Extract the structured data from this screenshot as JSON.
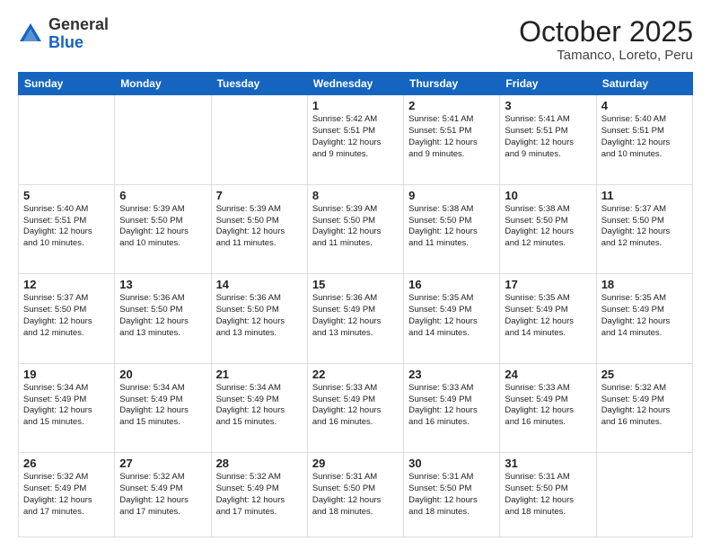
{
  "header": {
    "logo_general": "General",
    "logo_blue": "Blue",
    "month": "October 2025",
    "location": "Tamanco, Loreto, Peru"
  },
  "days_of_week": [
    "Sunday",
    "Monday",
    "Tuesday",
    "Wednesday",
    "Thursday",
    "Friday",
    "Saturday"
  ],
  "weeks": [
    [
      {
        "day": "",
        "content": "",
        "empty": true
      },
      {
        "day": "",
        "content": "",
        "empty": true
      },
      {
        "day": "",
        "content": "",
        "empty": true
      },
      {
        "day": "1",
        "content": "Sunrise: 5:42 AM\nSunset: 5:51 PM\nDaylight: 12 hours\nand 9 minutes."
      },
      {
        "day": "2",
        "content": "Sunrise: 5:41 AM\nSunset: 5:51 PM\nDaylight: 12 hours\nand 9 minutes."
      },
      {
        "day": "3",
        "content": "Sunrise: 5:41 AM\nSunset: 5:51 PM\nDaylight: 12 hours\nand 9 minutes."
      },
      {
        "day": "4",
        "content": "Sunrise: 5:40 AM\nSunset: 5:51 PM\nDaylight: 12 hours\nand 10 minutes."
      }
    ],
    [
      {
        "day": "5",
        "content": "Sunrise: 5:40 AM\nSunset: 5:51 PM\nDaylight: 12 hours\nand 10 minutes."
      },
      {
        "day": "6",
        "content": "Sunrise: 5:39 AM\nSunset: 5:50 PM\nDaylight: 12 hours\nand 10 minutes."
      },
      {
        "day": "7",
        "content": "Sunrise: 5:39 AM\nSunset: 5:50 PM\nDaylight: 12 hours\nand 11 minutes."
      },
      {
        "day": "8",
        "content": "Sunrise: 5:39 AM\nSunset: 5:50 PM\nDaylight: 12 hours\nand 11 minutes."
      },
      {
        "day": "9",
        "content": "Sunrise: 5:38 AM\nSunset: 5:50 PM\nDaylight: 12 hours\nand 11 minutes."
      },
      {
        "day": "10",
        "content": "Sunrise: 5:38 AM\nSunset: 5:50 PM\nDaylight: 12 hours\nand 12 minutes."
      },
      {
        "day": "11",
        "content": "Sunrise: 5:37 AM\nSunset: 5:50 PM\nDaylight: 12 hours\nand 12 minutes."
      }
    ],
    [
      {
        "day": "12",
        "content": "Sunrise: 5:37 AM\nSunset: 5:50 PM\nDaylight: 12 hours\nand 12 minutes."
      },
      {
        "day": "13",
        "content": "Sunrise: 5:36 AM\nSunset: 5:50 PM\nDaylight: 12 hours\nand 13 minutes."
      },
      {
        "day": "14",
        "content": "Sunrise: 5:36 AM\nSunset: 5:50 PM\nDaylight: 12 hours\nand 13 minutes."
      },
      {
        "day": "15",
        "content": "Sunrise: 5:36 AM\nSunset: 5:49 PM\nDaylight: 12 hours\nand 13 minutes."
      },
      {
        "day": "16",
        "content": "Sunrise: 5:35 AM\nSunset: 5:49 PM\nDaylight: 12 hours\nand 14 minutes."
      },
      {
        "day": "17",
        "content": "Sunrise: 5:35 AM\nSunset: 5:49 PM\nDaylight: 12 hours\nand 14 minutes."
      },
      {
        "day": "18",
        "content": "Sunrise: 5:35 AM\nSunset: 5:49 PM\nDaylight: 12 hours\nand 14 minutes."
      }
    ],
    [
      {
        "day": "19",
        "content": "Sunrise: 5:34 AM\nSunset: 5:49 PM\nDaylight: 12 hours\nand 15 minutes."
      },
      {
        "day": "20",
        "content": "Sunrise: 5:34 AM\nSunset: 5:49 PM\nDaylight: 12 hours\nand 15 minutes."
      },
      {
        "day": "21",
        "content": "Sunrise: 5:34 AM\nSunset: 5:49 PM\nDaylight: 12 hours\nand 15 minutes."
      },
      {
        "day": "22",
        "content": "Sunrise: 5:33 AM\nSunset: 5:49 PM\nDaylight: 12 hours\nand 16 minutes."
      },
      {
        "day": "23",
        "content": "Sunrise: 5:33 AM\nSunset: 5:49 PM\nDaylight: 12 hours\nand 16 minutes."
      },
      {
        "day": "24",
        "content": "Sunrise: 5:33 AM\nSunset: 5:49 PM\nDaylight: 12 hours\nand 16 minutes."
      },
      {
        "day": "25",
        "content": "Sunrise: 5:32 AM\nSunset: 5:49 PM\nDaylight: 12 hours\nand 16 minutes."
      }
    ],
    [
      {
        "day": "26",
        "content": "Sunrise: 5:32 AM\nSunset: 5:49 PM\nDaylight: 12 hours\nand 17 minutes."
      },
      {
        "day": "27",
        "content": "Sunrise: 5:32 AM\nSunset: 5:49 PM\nDaylight: 12 hours\nand 17 minutes."
      },
      {
        "day": "28",
        "content": "Sunrise: 5:32 AM\nSunset: 5:49 PM\nDaylight: 12 hours\nand 17 minutes."
      },
      {
        "day": "29",
        "content": "Sunrise: 5:31 AM\nSunset: 5:50 PM\nDaylight: 12 hours\nand 18 minutes."
      },
      {
        "day": "30",
        "content": "Sunrise: 5:31 AM\nSunset: 5:50 PM\nDaylight: 12 hours\nand 18 minutes."
      },
      {
        "day": "31",
        "content": "Sunrise: 5:31 AM\nSunset: 5:50 PM\nDaylight: 12 hours\nand 18 minutes."
      },
      {
        "day": "",
        "content": "",
        "empty": true
      }
    ]
  ]
}
